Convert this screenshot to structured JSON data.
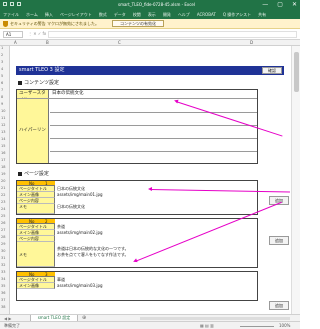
{
  "window": {
    "title": "smart_TLEO_fide-0728-45.xlsm - Excel",
    "controls": [
      "—",
      "▢",
      "✕"
    ]
  },
  "ribbon": {
    "tabs": [
      "ファイル",
      "ホーム",
      "挿入",
      "ページレイアウト",
      "数式",
      "データ",
      "校閲",
      "表示",
      "開発",
      "ヘルプ",
      "ACROBAT",
      "Q 操作アシスト",
      "共有"
    ]
  },
  "security_bar": {
    "message": "セキュリティの警告 マクロが無効にされました。",
    "button": "コンテンツの有効化"
  },
  "formula_bar": {
    "name_box": "A1",
    "icons": "⋮ ✕ ✓ fx"
  },
  "columns": [
    "A",
    "B",
    "C",
    "D"
  ],
  "rows": [
    "1",
    "2",
    "3",
    "4",
    "5",
    "6",
    "7",
    "8",
    "9",
    "10",
    "11",
    "12",
    "13",
    "14",
    "15",
    "16",
    "17",
    "18",
    "19",
    "20",
    "21",
    "22",
    "23",
    "24",
    "25",
    "26",
    "27",
    "28",
    "29",
    "30",
    "31",
    "32",
    "33",
    "34",
    "35",
    "36",
    "37",
    "38"
  ],
  "sheet": {
    "title": "smart TLEO 3 設定",
    "title_button": "確認",
    "contents_heading": "コンテンツ設定",
    "site_title_label": "ユーザースタイル",
    "site_title_value": "日本の伝統文化",
    "hyperlink_label": "ハイパーリンク",
    "page_heading": "ページ設定",
    "pages": [
      {
        "no_label": "No",
        "no": "1",
        "rows": [
          {
            "label": "ページタイトル",
            "value": "日本の伝統文化"
          },
          {
            "label": "メイン画像",
            "value": "assets/img/main01.jpg"
          },
          {
            "label": "ページ内容",
            "value": ""
          },
          {
            "label": "メモ",
            "value": "日本の伝統文化"
          }
        ],
        "button": "追加"
      },
      {
        "no_label": "No",
        "no": "2",
        "rows": [
          {
            "label": "ページタイトル",
            "value": "茶道"
          },
          {
            "label": "メイン画像",
            "value": "assets/img/main02.jpg"
          },
          {
            "label": "ページ内容",
            "value": ""
          },
          {
            "label": "メモ",
            "value": "茶道は日本の伝統的な文化の一つです。"
          },
          {
            "label": "",
            "value": "お茶を点てて客人をもてなす作法です。"
          }
        ],
        "button": "追加"
      },
      {
        "no_label": "No",
        "no": "3",
        "rows": [
          {
            "label": "ページタイトル",
            "value": "華道"
          },
          {
            "label": "メイン画像",
            "value": "assets/img/main03.jpg"
          }
        ],
        "button": "追加"
      }
    ]
  },
  "sheet_tabs": {
    "nav": "◀ ▶",
    "active": "smart TLEO 設定",
    "add": "⊕"
  },
  "status_bar": {
    "ready": "準備完了",
    "views": "▦ ▤ ▥",
    "zoom": "100%"
  },
  "colors": {
    "excel_green": "#217346",
    "banner_blue": "#1f3296",
    "label_yellow": "#fff799",
    "header_orange": "#ffc000",
    "arrow_magenta": "#e600c8"
  }
}
